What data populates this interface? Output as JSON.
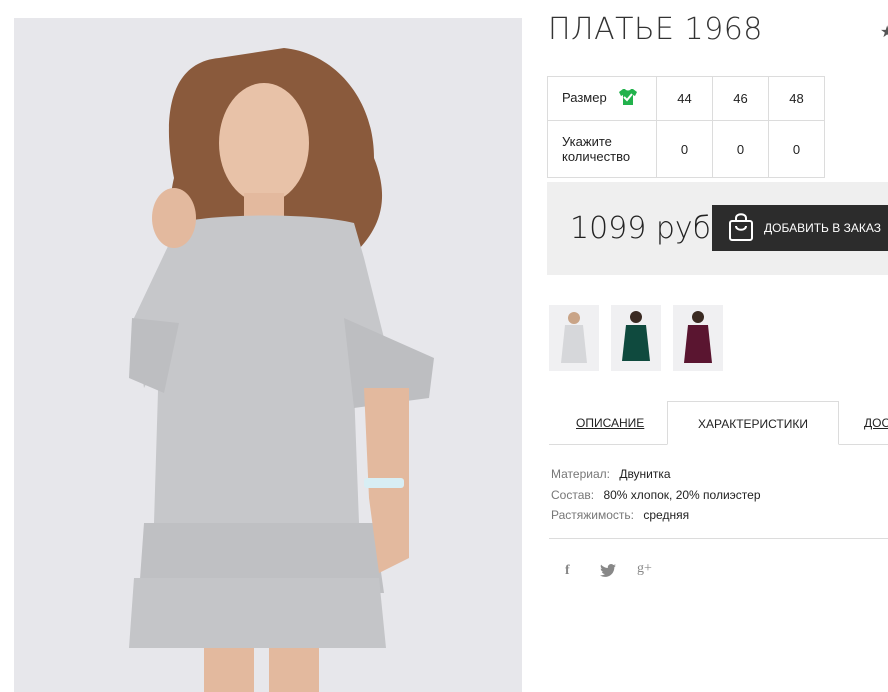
{
  "product": {
    "title": "ПЛАТЬЕ 1968",
    "favorite_icon": "star-icon"
  },
  "size_table": {
    "size_label": "Размер",
    "size_icon": "shirt-check-icon",
    "size_icon_color": "#22b24c",
    "sizes": [
      "44",
      "46",
      "48"
    ],
    "qty_label_line1": "Укажите",
    "qty_label_line2": "количество",
    "quantities": [
      "0",
      "0",
      "0"
    ]
  },
  "purchase": {
    "price": "1099 руб",
    "add_to_cart_label": "ДОБАВИТЬ В ЗАКАЗ",
    "cart_icon": "shopping-bag-icon"
  },
  "thumbnails": [
    {
      "color_name": "grey",
      "dress_color": "#c9cacd"
    },
    {
      "color_name": "green",
      "dress_color": "#0f4a3e"
    },
    {
      "color_name": "burgundy",
      "dress_color": "#5a1530"
    }
  ],
  "tabs": {
    "description": "ОПИСАНИЕ",
    "characteristics": "ХАРАКТЕРИСТИКИ",
    "delivery": "ДОСТАВКА"
  },
  "specs": [
    {
      "key": "Материал:",
      "value": "Двунитка"
    },
    {
      "key": "Состав:",
      "value": "80% хлопок, 20% полиэстер"
    },
    {
      "key": "Растяжимость:",
      "value": "средняя"
    }
  ],
  "social": {
    "facebook": "f",
    "twitter": "twitter-icon",
    "google": "g+"
  },
  "colors": {
    "dark_button": "#2c2c2c",
    "price_bg": "#efefef",
    "border": "#dcdcdc"
  }
}
